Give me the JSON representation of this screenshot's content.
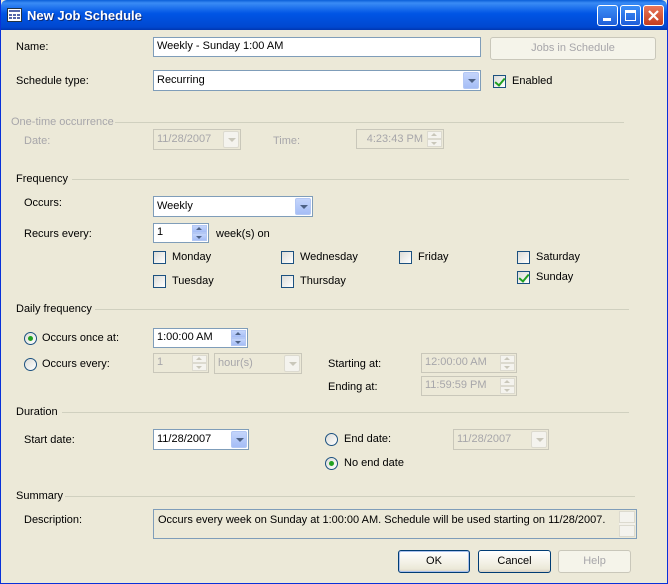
{
  "window": {
    "title": "New Job Schedule"
  },
  "main": {
    "name_label": "Name:",
    "name_value": "Weekly - Sunday 1:00 AM",
    "jobs_button": "Jobs in Schedule",
    "schedule_type_label": "Schedule type:",
    "schedule_type_value": "Recurring",
    "enabled_label": "Enabled",
    "enabled_checked": true
  },
  "one_time": {
    "header": "One-time occurrence",
    "date_label": "Date:",
    "date_value": "11/28/2007",
    "time_label": "Time:",
    "time_value": "4:23:43 PM"
  },
  "frequency": {
    "header": "Frequency",
    "occurs_label": "Occurs:",
    "occurs_value": "Weekly",
    "recurs_label": "Recurs every:",
    "recurs_value": "1",
    "recurs_unit": "week(s) on",
    "days": {
      "monday": "Monday",
      "tuesday": "Tuesday",
      "wednesday": "Wednesday",
      "thursday": "Thursday",
      "friday": "Friday",
      "saturday": "Saturday",
      "sunday": "Sunday"
    },
    "checked_day": "Sunday"
  },
  "daily": {
    "header": "Daily frequency",
    "once_label": "Occurs once at:",
    "once_value": "1:00:00 AM",
    "every_label": "Occurs every:",
    "every_value": "1",
    "every_unit": "hour(s)",
    "starting_label": "Starting at:",
    "starting_value": "12:00:00 AM",
    "ending_label": "Ending at:",
    "ending_value": "11:59:59 PM"
  },
  "duration": {
    "header": "Duration",
    "start_label": "Start date:",
    "start_value": "11/28/2007",
    "end_label": "End date:",
    "end_value": "11/28/2007",
    "no_end_label": "No end date"
  },
  "summary": {
    "header": "Summary",
    "description_label": "Description:",
    "description_value": "Occurs every week on Sunday at 1:00:00 AM. Schedule will be used starting on 11/28/2007."
  },
  "buttons": {
    "ok": "OK",
    "cancel": "Cancel",
    "help": "Help"
  },
  "colors": {
    "title_bar": "#0055e5",
    "dialog": "#ece9d8",
    "disabled_text": "#a7a6aa",
    "check_mark": "#21a121"
  },
  "icons": [
    "window-icon",
    "minimize-icon",
    "maximize-icon",
    "close-icon",
    "dropdown-arrow-icon",
    "spin-up-icon",
    "spin-down-icon"
  ]
}
